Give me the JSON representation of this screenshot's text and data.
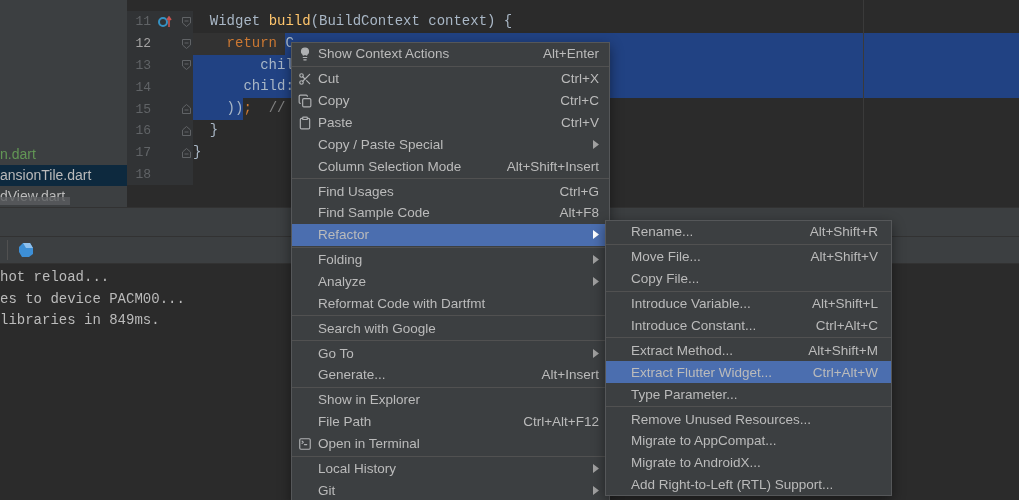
{
  "project_files": [
    {
      "name": "n.dart",
      "color": "#629755",
      "selected": false
    },
    {
      "name": "ansionTile.dart",
      "color": "#bbbbbb",
      "selected": true
    },
    {
      "name": "dView.dart",
      "color": "#bbbbbb",
      "selected": false
    }
  ],
  "editor": {
    "lines": [
      {
        "number": "11",
        "current": false,
        "selected_to_end": false,
        "gutter_marker": true,
        "fold_start": true,
        "fold_end": false,
        "tokens": [
          {
            "text": "  Widget ",
            "kind": "plain",
            "selected": false
          },
          {
            "text": "build",
            "kind": "function",
            "selected": false
          },
          {
            "text": "(BuildContext context) {",
            "kind": "plain",
            "selected": false
          }
        ]
      },
      {
        "number": "12",
        "current": true,
        "selected_to_end": true,
        "gutter_marker": false,
        "fold_start": true,
        "fold_end": false,
        "tokens": [
          {
            "text": "    return ",
            "kind": "keyword",
            "selected": false
          },
          {
            "text": "C",
            "kind": "plain",
            "selected": true
          }
        ]
      },
      {
        "number": "13",
        "current": false,
        "selected_to_end": true,
        "gutter_marker": false,
        "fold_start": true,
        "fold_end": false,
        "tokens": [
          {
            "text": "        chil",
            "kind": "plain",
            "selected": true
          }
        ]
      },
      {
        "number": "14",
        "current": false,
        "selected_to_end": true,
        "gutter_marker": false,
        "fold_start": false,
        "fold_end": false,
        "tokens": [
          {
            "text": "      child:",
            "kind": "plain",
            "selected": true
          }
        ]
      },
      {
        "number": "15",
        "current": false,
        "selected_to_end": false,
        "gutter_marker": false,
        "fold_start": false,
        "fold_end": true,
        "tokens": [
          {
            "text": "    ))",
            "kind": "plain",
            "selected": true
          },
          {
            "text": ";",
            "kind": "keyword",
            "selected": false
          },
          {
            "text": "  //",
            "kind": "comment",
            "selected": false
          }
        ]
      },
      {
        "number": "16",
        "current": false,
        "selected_to_end": false,
        "gutter_marker": false,
        "fold_start": false,
        "fold_end": true,
        "tokens": [
          {
            "text": "  }",
            "kind": "plain",
            "selected": false
          }
        ]
      },
      {
        "number": "17",
        "current": false,
        "selected_to_end": false,
        "gutter_marker": false,
        "fold_start": false,
        "fold_end": true,
        "tokens": [
          {
            "text": "}",
            "kind": "plain",
            "selected": false
          }
        ]
      },
      {
        "number": "18",
        "current": false,
        "selected_to_end": false,
        "gutter_marker": false,
        "fold_start": false,
        "fold_end": false
      }
    ]
  },
  "run_panel": {
    "console": [
      "hot reload...",
      "es to device PACM00...",
      "libraries in 849ms."
    ]
  },
  "context_menu": {
    "groups": [
      [
        {
          "label": "Show Context Actions",
          "shortcut": "Alt+Enter",
          "kind": "intention",
          "selected": false
        }
      ],
      [
        {
          "label": "Cut",
          "shortcut": "Ctrl+X",
          "kind": "cut",
          "selected": false
        },
        {
          "label": "Copy",
          "shortcut": "Ctrl+C",
          "kind": "copy",
          "selected": false
        },
        {
          "label": "Paste",
          "shortcut": "Ctrl+V",
          "kind": "paste",
          "selected": false
        },
        {
          "label": "Copy / Paste Special",
          "submenu": true,
          "selected": false
        },
        {
          "label": "Column Selection Mode",
          "shortcut": "Alt+Shift+Insert",
          "selected": false
        }
      ],
      [
        {
          "label": "Find Usages",
          "shortcut": "Ctrl+G",
          "selected": false
        },
        {
          "label": "Find Sample Code",
          "shortcut": "Alt+F8",
          "selected": false
        },
        {
          "label": "Refactor",
          "submenu": true,
          "selected": true
        }
      ],
      [
        {
          "label": "Folding",
          "submenu": true,
          "selected": false
        },
        {
          "label": "Analyze",
          "submenu": true,
          "selected": false
        },
        {
          "label": "Reformat Code with Dartfmt",
          "selected": false
        }
      ],
      [
        {
          "label": "Search with Google",
          "selected": false
        }
      ],
      [
        {
          "label": "Go To",
          "submenu": true,
          "selected": false
        },
        {
          "label": "Generate...",
          "shortcut": "Alt+Insert",
          "selected": false
        }
      ],
      [
        {
          "label": "Show in Explorer",
          "selected": false
        },
        {
          "label": "File Path",
          "shortcut": "Ctrl+Alt+F12",
          "selected": false
        },
        {
          "label": "Open in Terminal",
          "kind": "terminal",
          "selected": false
        }
      ],
      [
        {
          "label": "Local History",
          "submenu": true,
          "selected": false
        },
        {
          "label": "Git",
          "submenu": true,
          "selected": false
        }
      ]
    ]
  },
  "refactor_submenu": {
    "groups": [
      [
        {
          "label": "Rename...",
          "shortcut": "Alt+Shift+R",
          "selected": false
        }
      ],
      [
        {
          "label": "Move File...",
          "shortcut": "Alt+Shift+V",
          "selected": false
        },
        {
          "label": "Copy File...",
          "selected": false
        }
      ],
      [
        {
          "label": "Introduce Variable...",
          "shortcut": "Alt+Shift+L",
          "selected": false
        },
        {
          "label": "Introduce Constant...",
          "shortcut": "Ctrl+Alt+C",
          "selected": false
        }
      ],
      [
        {
          "label": "Extract Method...",
          "shortcut": "Alt+Shift+M",
          "selected": false
        },
        {
          "label": "Extract Flutter Widget...",
          "shortcut": "Ctrl+Alt+W",
          "selected": true
        },
        {
          "label": "Type Parameter...",
          "selected": false
        }
      ],
      [
        {
          "label": "Remove Unused Resources...",
          "selected": false
        },
        {
          "label": "Migrate to AppCompat...",
          "selected": false
        },
        {
          "label": "Migrate to AndroidX...",
          "selected": false
        },
        {
          "label": "Add Right-to-Left (RTL) Support...",
          "selected": false
        }
      ]
    ]
  }
}
